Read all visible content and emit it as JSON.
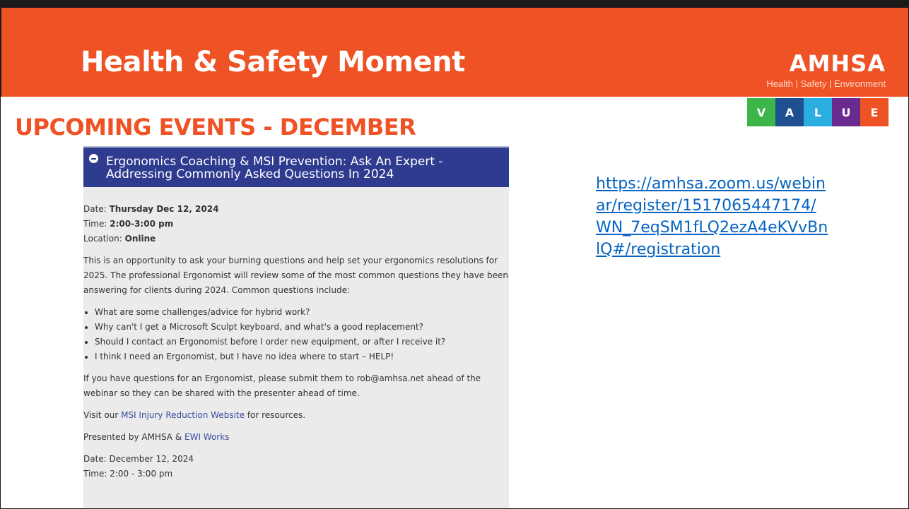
{
  "slide": {
    "title": "Health & Safety Moment",
    "section_heading": "UPCOMING EVENTS - DECEMBER"
  },
  "logo": {
    "wordmark": "AMHSA",
    "tagline": "Health | Safety | Environment"
  },
  "value_bar": [
    {
      "letter": "V",
      "color": "#3cb54a"
    },
    {
      "letter": "A",
      "color": "#1f4f8f"
    },
    {
      "letter": "L",
      "color": "#2aaee0"
    },
    {
      "letter": "U",
      "color": "#6a2a8f"
    },
    {
      "letter": "E",
      "color": "#ee5225"
    }
  ],
  "event": {
    "title": "Ergonomics Coaching & MSI Prevention: Ask An Expert - Addressing Commonly Asked Questions In 2024",
    "date_label": "Date:",
    "date_value": "Thursday Dec 12, 2024",
    "time_label": "Time:",
    "time_value": "2:00-3:00 pm",
    "location_label": "Location:",
    "location_value": "Online",
    "description": "This is an opportunity to ask your burning questions and help set your ergonomics resolutions for 2025. The professional Ergonomist will review some of the most common questions they have been answering for clients during 2024. Common questions include:",
    "questions": [
      "What are some challenges/advice for hybrid work?",
      "Why can't I get a Microsoft Sculpt keyboard, and what's a good replacement?",
      "Should I contact an Ergonomist before I order new equipment, or after I receive it?",
      "I think I need an Ergonomist, but I have no idea where to start – HELP!"
    ],
    "submit_note": "If you have questions for an Ergonomist, please submit them to rob@amhsa.net ahead of the webinar so they can be shared with the presenter ahead of time.",
    "visit_prefix": "Visit our ",
    "visit_link": "MSI Injury Reduction Website",
    "visit_suffix": " for resources.",
    "presented_prefix": "Presented by AMHSA & ",
    "presented_link": "EWI Works",
    "date_line": "Date: December 12, 2024",
    "time_line": "Time: 2:00 - 3:00 pm"
  },
  "registration_link": "https://amhsa.zoom.us/webinar/register/1517065447174/WN_7eqSM1fLQ2ezA4eKVvBnlQ#/registration",
  "colors": {
    "brand_orange": "#ee5225",
    "panel_header_blue": "#2e3b8f",
    "link_blue": "#0563c1"
  }
}
